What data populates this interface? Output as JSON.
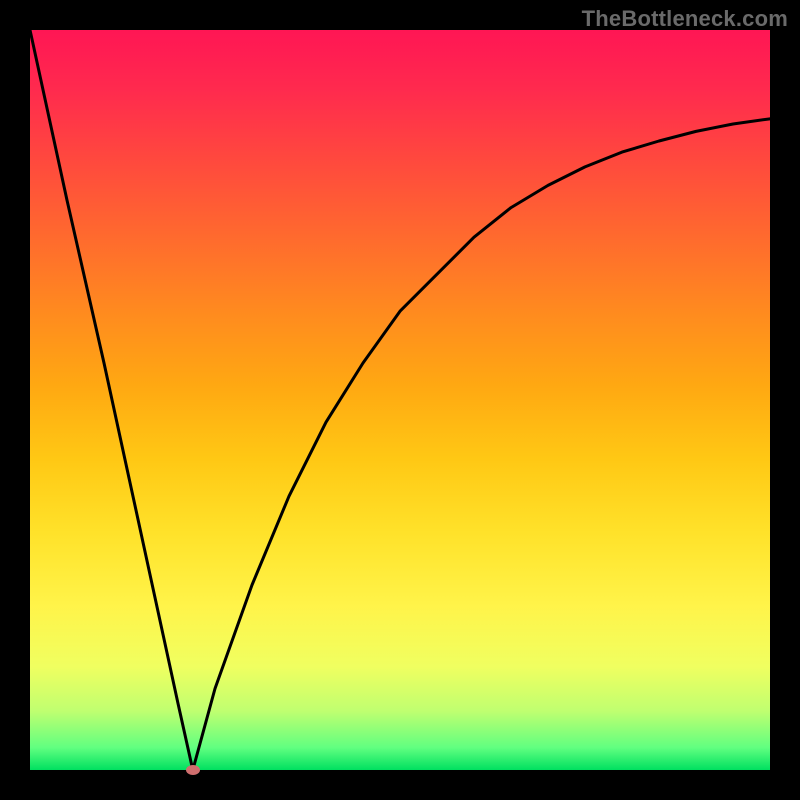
{
  "watermark": "TheBottleneck.com",
  "colors": {
    "frame": "#000000",
    "curve": "#000000",
    "marker": "#cf6e6e",
    "gradient_top": "#ff1654",
    "gradient_bottom": "#00e060"
  },
  "chart_data": {
    "type": "line",
    "title": "",
    "xlabel": "",
    "ylabel": "",
    "xlim": [
      0,
      100
    ],
    "ylim": [
      0,
      100
    ],
    "grid": false,
    "legend": false,
    "description": "V-shaped bottleneck curve. Left segment descends steeply from 100 at x=0 to 0 at x≈22. Right segment rises as a concave (saturating) curve from 0 at x≈22 toward about 88 at x=100.",
    "series": [
      {
        "name": "bottleneck-curve",
        "x": [
          0,
          5,
          10,
          15,
          20,
          22,
          25,
          30,
          35,
          40,
          45,
          50,
          55,
          60,
          65,
          70,
          75,
          80,
          85,
          90,
          95,
          100
        ],
        "values": [
          100,
          77,
          55,
          32,
          9,
          0,
          11,
          25,
          37,
          47,
          55,
          62,
          67,
          72,
          76,
          79,
          81.5,
          83.5,
          85,
          86.3,
          87.3,
          88
        ]
      }
    ],
    "marker": {
      "x": 22,
      "y": 0
    }
  }
}
